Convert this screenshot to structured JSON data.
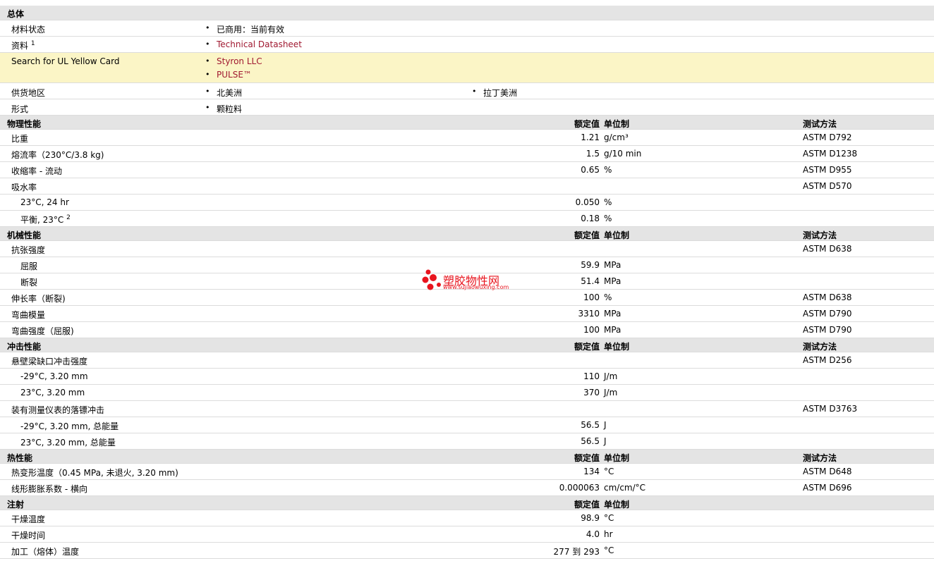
{
  "general": {
    "title": "总体",
    "status_label": "材料状态",
    "status_value": "已商用：当前有效",
    "info_label": "资料",
    "info_sup": "1",
    "info_link": "Technical Datasheet",
    "ul_label": "Search for UL Yellow Card",
    "ul_link1": "Styron LLC",
    "ul_link2": "PULSE™",
    "supply_label": "供货地区",
    "supply1": "北美洲",
    "supply2": "拉丁美洲",
    "form_label": "形式",
    "form_value": "颗粒料"
  },
  "headers": {
    "value": "额定值",
    "unit": "单位制",
    "method": "测试方法"
  },
  "physical": {
    "title": "物理性能",
    "rows": [
      {
        "label": "比重",
        "value": "1.21",
        "unit": "g/cm³",
        "method": "ASTM D792"
      },
      {
        "label": "熔流率（230°C/3.8 kg)",
        "value": "1.5",
        "unit": "g/10 min",
        "method": "ASTM D1238"
      },
      {
        "label": "收缩率 - 流动",
        "value": "0.65",
        "unit": "%",
        "method": "ASTM D955"
      },
      {
        "label": "吸水率",
        "value": "",
        "unit": "",
        "method": "ASTM D570"
      },
      {
        "label": "23°C, 24 hr",
        "value": "0.050",
        "unit": "%",
        "method": ""
      },
      {
        "label": "平衡, 23°C",
        "sup": "2",
        "value": "0.18",
        "unit": "%",
        "method": ""
      }
    ]
  },
  "mechanical": {
    "title": "机械性能",
    "rows": [
      {
        "label": "抗张强度",
        "value": "",
        "unit": "",
        "method": "ASTM D638"
      },
      {
        "label": "屈服",
        "value": "59.9",
        "unit": "MPa",
        "method": ""
      },
      {
        "label": "断裂",
        "value": "51.4",
        "unit": "MPa",
        "method": ""
      },
      {
        "label": "伸长率（断裂)",
        "value": "100",
        "unit": "%",
        "method": "ASTM D638"
      },
      {
        "label": "弯曲模量",
        "value": "3310",
        "unit": "MPa",
        "method": "ASTM D790"
      },
      {
        "label": "弯曲强度（屈服)",
        "value": "100",
        "unit": "MPa",
        "method": "ASTM D790"
      }
    ]
  },
  "impact": {
    "title": "冲击性能",
    "rows": [
      {
        "label": "悬壁梁缺口冲击强度",
        "value": "",
        "unit": "",
        "method": "ASTM D256"
      },
      {
        "label": "-29°C, 3.20 mm",
        "value": "110",
        "unit": "J/m",
        "method": ""
      },
      {
        "label": "23°C, 3.20 mm",
        "value": "370",
        "unit": "J/m",
        "method": ""
      },
      {
        "label": "装有测量仪表的落镖冲击",
        "value": "",
        "unit": "",
        "method": "ASTM D3763"
      },
      {
        "label": "-29°C, 3.20 mm, 总能量",
        "value": "56.5",
        "unit": "J",
        "method": ""
      },
      {
        "label": "23°C, 3.20 mm, 总能量",
        "value": "56.5",
        "unit": "J",
        "method": ""
      }
    ]
  },
  "thermal": {
    "title": "热性能",
    "rows": [
      {
        "label": "热变形温度（0.45 MPa, 未退火, 3.20 mm)",
        "value": "134",
        "unit": "°C",
        "method": "ASTM D648"
      },
      {
        "label": "线形膨胀系数 - 横向",
        "value": "0.000063",
        "unit": "cm/cm/°C",
        "method": "ASTM D696"
      }
    ]
  },
  "injection": {
    "title": "注射",
    "rows": [
      {
        "label": "干燥温度",
        "value": "98.9",
        "unit": "°C",
        "method": ""
      },
      {
        "label": "干燥时间",
        "value": "4.0",
        "unit": "hr",
        "method": ""
      },
      {
        "label": "加工（熔体）温度",
        "value": "277 到 293",
        "unit": "°C",
        "method": ""
      }
    ]
  },
  "watermark": {
    "name": "塑胶物性网",
    "url": "www.sujiaowuxing.com"
  },
  "colors": {
    "header_bg": "#e4e4e4",
    "highlight_bg": "#fbf5c6",
    "link": "#a01830"
  }
}
